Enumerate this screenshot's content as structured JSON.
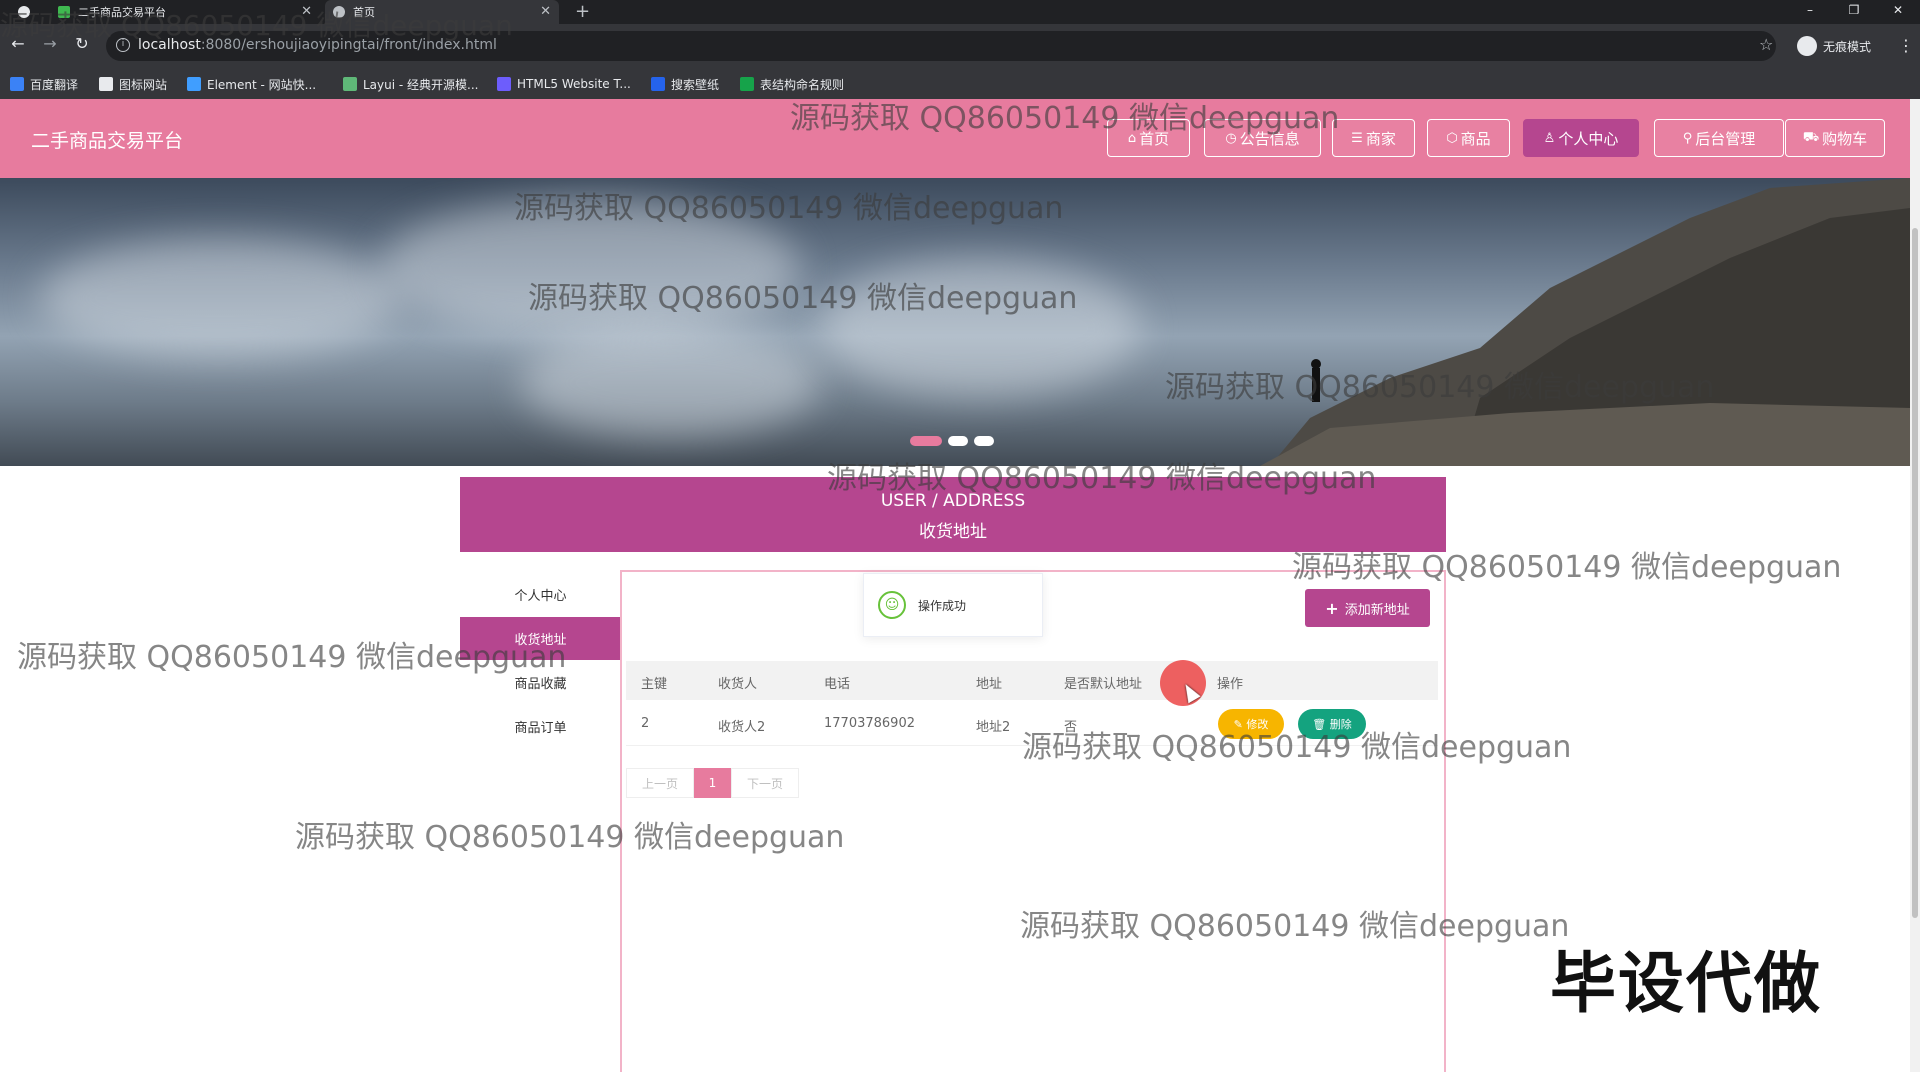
{
  "browser": {
    "tabs": [
      {
        "title": "二手商品交易平台"
      },
      {
        "title": "首页"
      }
    ],
    "url_host": "localhost",
    "url_path": ":8080/ershoujiaoyipingtai/front/index.html",
    "profile_label": "无痕模式",
    "bookmarks": [
      {
        "label": "百度翻译"
      },
      {
        "label": "图标网站"
      },
      {
        "label": "Element - 网站快..."
      },
      {
        "label": "Layui - 经典开源模..."
      },
      {
        "label": "HTML5 Website T..."
      },
      {
        "label": "搜索壁纸"
      },
      {
        "label": "表结构命名规则"
      }
    ]
  },
  "site": {
    "title": "二手商品交易平台",
    "nav": [
      {
        "label": "首页"
      },
      {
        "label": "公告信息"
      },
      {
        "label": "商家"
      },
      {
        "label": "商品"
      },
      {
        "label": "个人中心",
        "active": true
      },
      {
        "label": "后台管理"
      },
      {
        "label": "购物车"
      }
    ]
  },
  "banner": {
    "dots": 3,
    "active_dot": 1
  },
  "section": {
    "title_en": "USER / ADDRESS",
    "title_cn": "收货地址"
  },
  "sidebar": {
    "items": [
      {
        "label": "个人中心"
      },
      {
        "label": "收货地址",
        "active": true
      },
      {
        "label": "商品收藏"
      },
      {
        "label": "商品订单"
      }
    ]
  },
  "toast": {
    "message": "操作成功"
  },
  "add_button": {
    "label": "添加新地址"
  },
  "table": {
    "headers": [
      "主键",
      "收货人",
      "电话",
      "地址",
      "是否默认地址",
      "操作"
    ],
    "rows": [
      {
        "id": "2",
        "name": "收货人2",
        "phone": "17703786902",
        "address": "地址2",
        "is_default": "否",
        "edit": "修改",
        "delete": "删除"
      }
    ]
  },
  "pagination": {
    "prev": "上一页",
    "current": "1",
    "next": "下一页"
  },
  "watermark": {
    "text": "源码获取 QQ86050149 微信deepguan"
  },
  "stamp": {
    "text": "毕设代做"
  },
  "colors": {
    "header_pink": "#e77b9e",
    "accent_purple": "#b5468f",
    "edit_yellow": "#f7b500",
    "delete_green": "#14a37f"
  }
}
